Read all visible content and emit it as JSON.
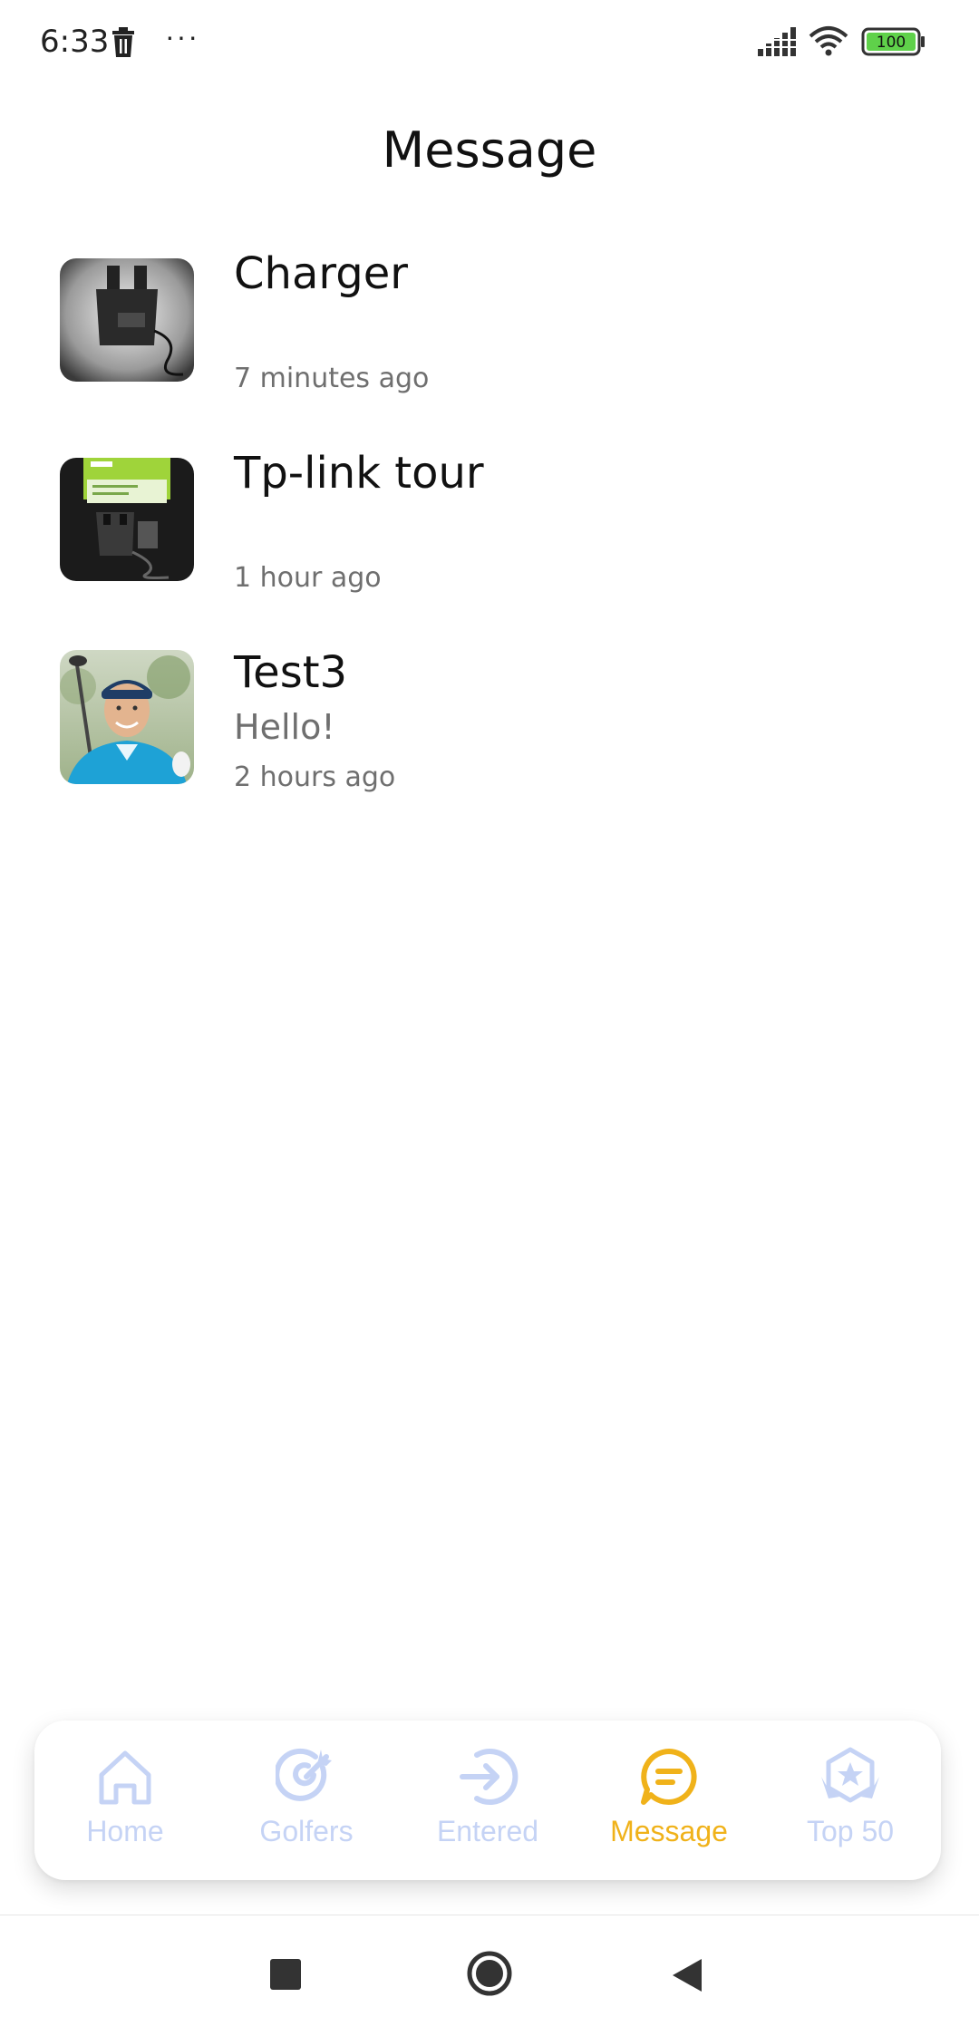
{
  "status_bar": {
    "time": "6:33",
    "dots": "···",
    "battery_level": "100",
    "icons": [
      "trash-icon",
      "more-dots-icon",
      "signal-icon",
      "wifi-icon",
      "battery-icon"
    ]
  },
  "header": {
    "title": "Message"
  },
  "messages": [
    {
      "name": "Charger",
      "text": "",
      "time": "7 minutes ago",
      "thumbnail": "charger-photo"
    },
    {
      "name": "Tp-link tour",
      "text": "",
      "time": "1 hour ago",
      "thumbnail": "tplink-charger-photo"
    },
    {
      "name": "Test3",
      "text": "Hello!",
      "time": "2 hours ago",
      "thumbnail": "golfer-avatar"
    }
  ],
  "bottom_nav": {
    "active_color": "#F0B21A",
    "inactive_color": "#C5D3F5",
    "items": [
      {
        "label": "Home",
        "icon": "home-icon",
        "active": false
      },
      {
        "label": "Golfers",
        "icon": "target-icon",
        "active": false
      },
      {
        "label": "Entered",
        "icon": "enter-arrow-icon",
        "active": false
      },
      {
        "label": "Message",
        "icon": "chat-bubble-icon",
        "active": true
      },
      {
        "label": "Top 50",
        "icon": "star-badge-icon",
        "active": false
      }
    ]
  },
  "system_nav": {
    "icons": [
      "recent-apps-icon",
      "home-circle-icon",
      "back-icon"
    ]
  }
}
